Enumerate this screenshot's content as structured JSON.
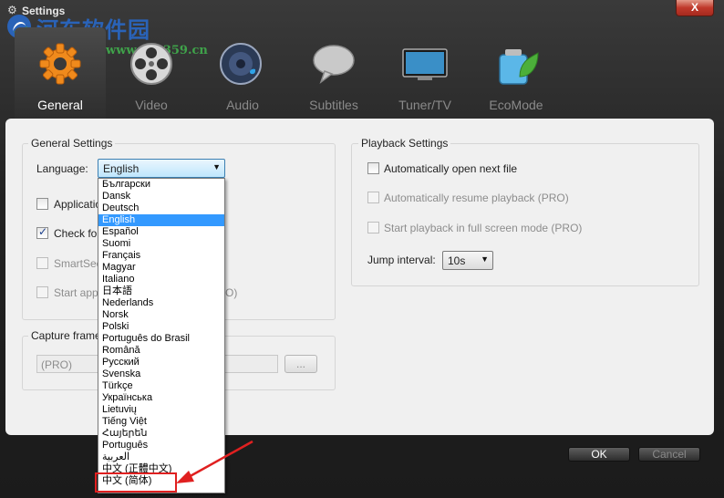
{
  "window": {
    "title": "Settings",
    "close_label": "X"
  },
  "watermark": {
    "text": "河东软件园",
    "url": "www.pc0359.cn"
  },
  "tabs": [
    {
      "label": "General",
      "icon": "gear-icon",
      "active": true
    },
    {
      "label": "Video",
      "icon": "film-reel-icon",
      "active": false
    },
    {
      "label": "Audio",
      "icon": "speaker-icon",
      "active": false
    },
    {
      "label": "Subtitles",
      "icon": "speech-bubble-icon",
      "active": false
    },
    {
      "label": "Tuner/TV",
      "icon": "tv-icon",
      "active": false
    },
    {
      "label": "EcoMode",
      "icon": "battery-leaf-icon",
      "active": false
    }
  ],
  "general": {
    "group_title": "General Settings",
    "language_label": "Language:",
    "language_value": "English",
    "options": [
      {
        "label": "Applicatio",
        "checked": false,
        "disabled": false
      },
      {
        "label": "Check for",
        "checked": true,
        "disabled": false
      },
      {
        "label": "SmartSeel",
        "checked": false,
        "disabled": true
      },
      {
        "label": "Start appl",
        "suffix": "O)",
        "checked": false,
        "disabled": true
      }
    ]
  },
  "capture": {
    "group_title": "Capture frame",
    "path_value": "(PRO)",
    "browse_label": "..."
  },
  "playback": {
    "group_title": "Playback Settings",
    "options": [
      {
        "label": "Automatically open next file",
        "checked": false,
        "disabled": false
      },
      {
        "label": "Automatically resume playback (PRO)",
        "checked": false,
        "disabled": true
      },
      {
        "label": "Start playback in full screen mode (PRO)",
        "checked": false,
        "disabled": true
      }
    ],
    "jump_label": "Jump interval:",
    "jump_value": "10s"
  },
  "language_list": {
    "items": [
      "Български",
      "Dansk",
      "Deutsch",
      "English",
      "Español",
      "Suomi",
      "Français",
      "Magyar",
      "Italiano",
      "日本語",
      "Nederlands",
      "Norsk",
      "Polski",
      "Português do Brasil",
      "Română",
      "Русский",
      "Svenska",
      "Türkçe",
      "Українська",
      "Lietuvių",
      "Tiếng Việt",
      "Հայերեն",
      "Português",
      "العربية",
      "中文 (正體中文)",
      "中文 (简体)"
    ],
    "selected_index": 3
  },
  "footer": {
    "ok_label": "OK",
    "cancel_label": "Cancel"
  },
  "colors": {
    "accent": "#3399ff",
    "annotation": "#e02020"
  }
}
